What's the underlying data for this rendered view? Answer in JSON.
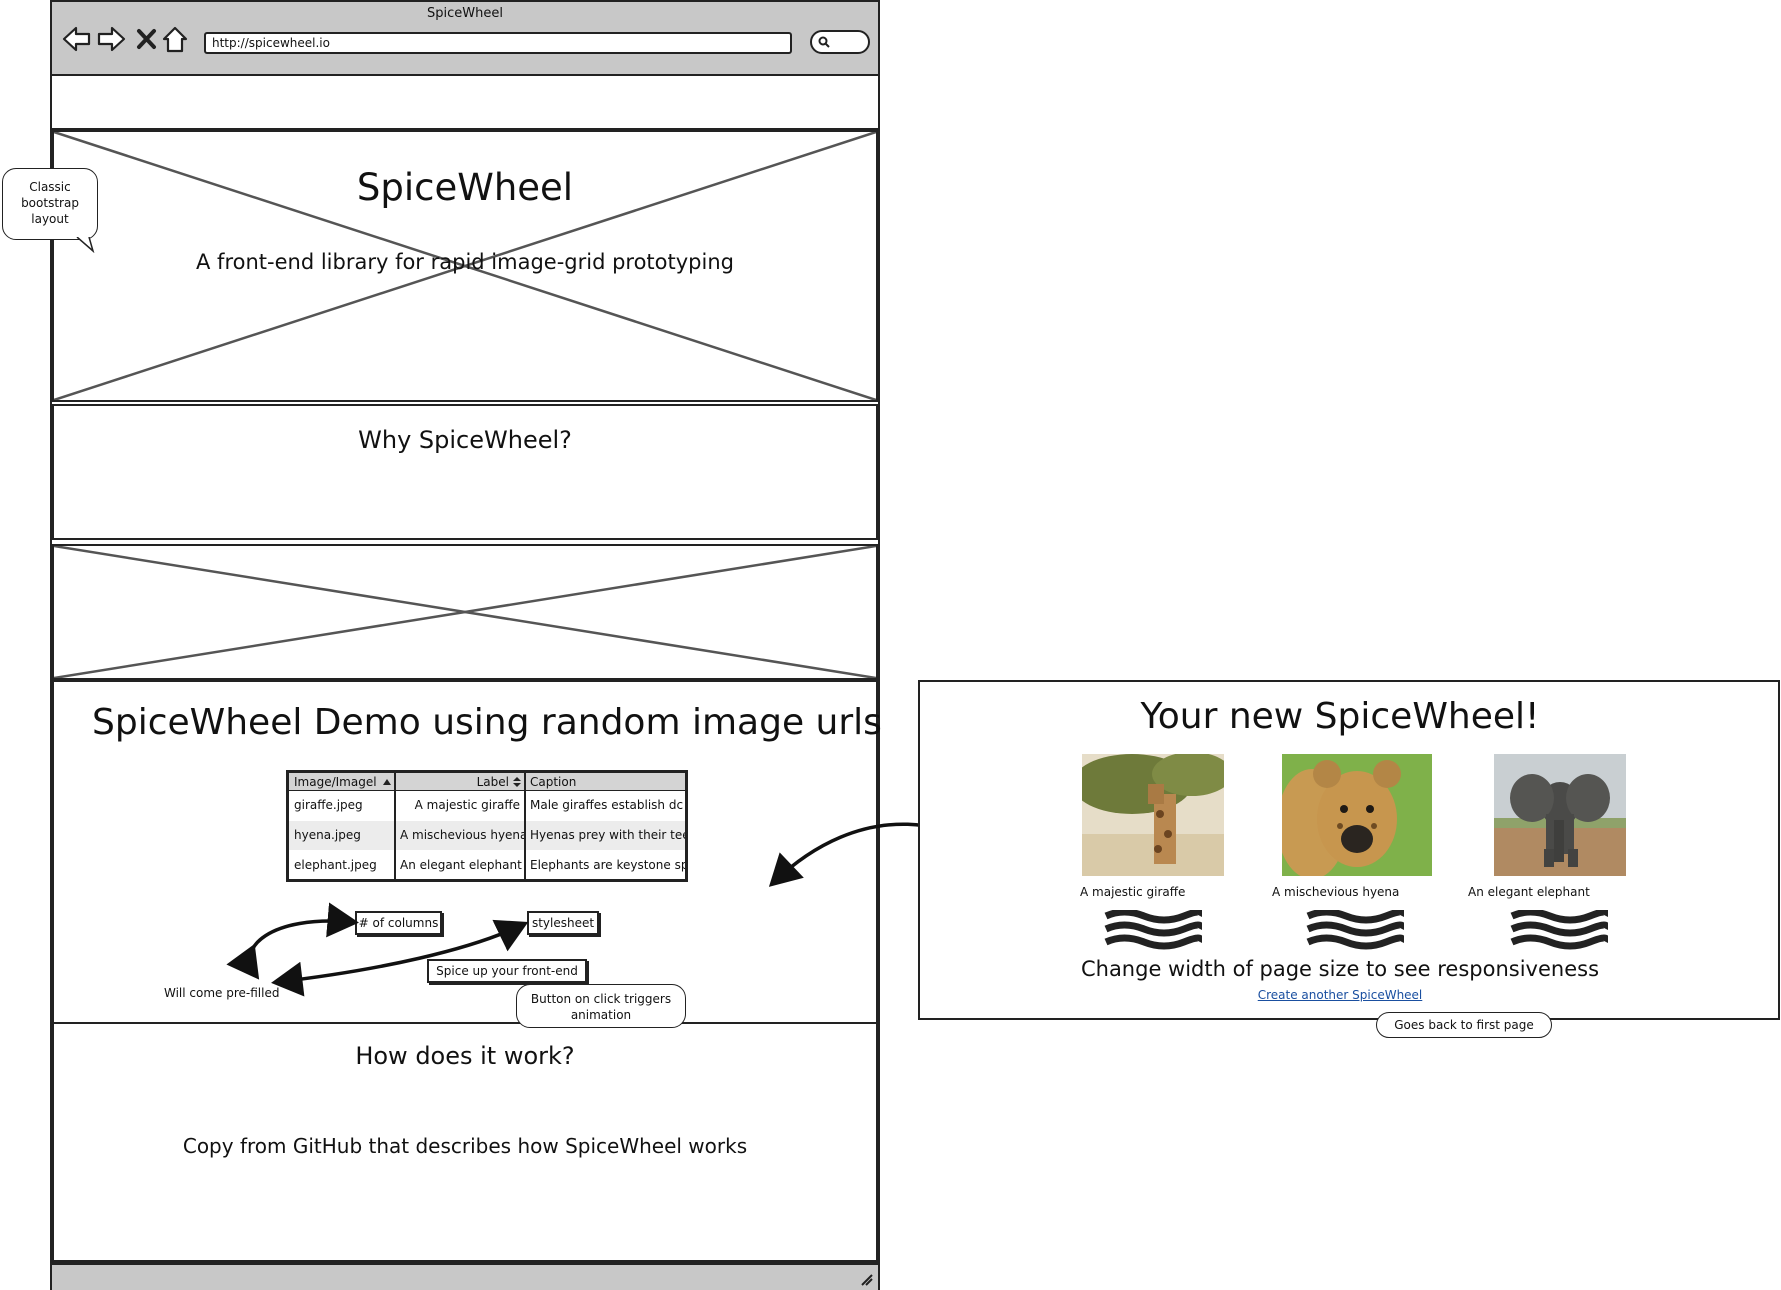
{
  "browser": {
    "title": "SpiceWheel",
    "url": "http://spicewheel.io",
    "nav_icons": [
      "back-arrow-icon",
      "forward-arrow-icon",
      "close-x-icon",
      "home-icon"
    ]
  },
  "callouts": {
    "classic_layout": "Classic bootstrap layout",
    "prefilled": "Will come pre-filled",
    "button_animation": "Button on click triggers animation",
    "goes_back": "Goes back to first page"
  },
  "hero": {
    "title": "SpiceWheel",
    "subtitle": "A front-end library for rapid image-grid prototyping"
  },
  "why": {
    "title": "Why SpiceWheel?"
  },
  "demo": {
    "title": "SpiceWheel Demo using random image urls",
    "table": {
      "headers": [
        "Image/Imagel",
        "Label",
        "Caption"
      ],
      "rows": [
        [
          "giraffe.jpeg",
          "A majestic giraffe",
          "Male giraffes establish dc"
        ],
        [
          "hyena.jpeg",
          "A mischevious hyena",
          "Hyenas prey with their tee"
        ],
        [
          "elephant.jpeg",
          "An elegant elephant",
          "Elephants are keystone sp"
        ]
      ]
    },
    "columns_label": "# of columns",
    "stylesheet_label": "stylesheet",
    "spice_button": "Spice up your front-end"
  },
  "how": {
    "title": "How does it work?",
    "body": "Copy from GitHub that describes how SpiceWheel works"
  },
  "result": {
    "title": "Your new SpiceWheel!",
    "images": [
      {
        "caption": "A majestic giraffe",
        "animal": "giraffe"
      },
      {
        "caption": "A mischevious hyena",
        "animal": "hyena"
      },
      {
        "caption": "An elegant elephant",
        "animal": "elephant"
      }
    ],
    "responsive_note": "Change width of page size to see responsiveness",
    "link": "Create another SpiceWheel"
  },
  "colors": {
    "frame": "#222222",
    "chrome": "#c8c8c8",
    "link": "#1a4fa0"
  }
}
